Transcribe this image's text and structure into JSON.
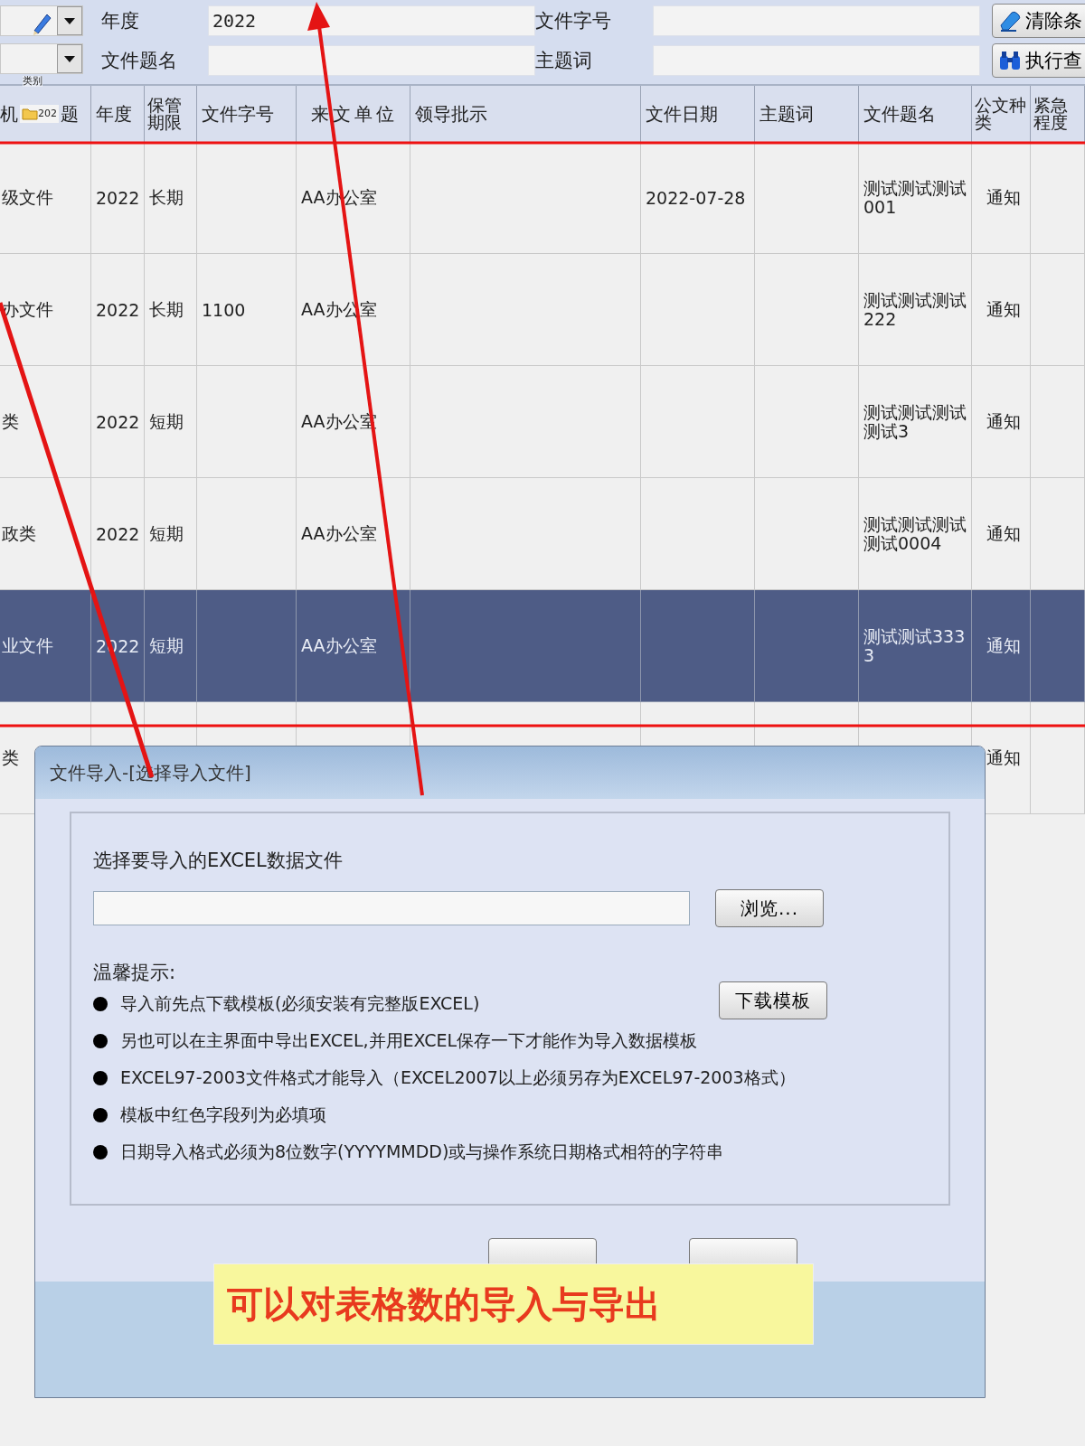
{
  "filter_bar": {
    "side_label": "类别",
    "fields": [
      {
        "label": "年度",
        "value": "2022"
      },
      {
        "label": "文件字号"
      },
      {
        "label": "文件题名"
      },
      {
        "label": "主题词"
      }
    ],
    "buttons": [
      {
        "kind": "clear",
        "label": "清除条"
      },
      {
        "kind": "search",
        "label": "执行查"
      }
    ]
  },
  "table": {
    "columns": [
      {
        "prefix": "机",
        "tag": "202",
        "label": "题"
      },
      {
        "label": "年度"
      },
      {
        "label": "保管期限"
      },
      {
        "label": "文件字号"
      },
      {
        "label": "来文单位"
      },
      {
        "label": "领导批示"
      },
      {
        "label": "文件日期"
      },
      {
        "label": "主题词"
      },
      {
        "label": "文件题名"
      },
      {
        "label": "公文种类"
      },
      {
        "label": "紧急程度"
      }
    ],
    "rows": [
      {
        "selected": false,
        "cells": [
          "级文件",
          "2022",
          "长期",
          "",
          "AA办公室",
          "",
          "2022-07-28",
          "",
          "测试测试测试001",
          "通知",
          ""
        ]
      },
      {
        "selected": false,
        "cells": [
          "办文件",
          "2022",
          "长期",
          "1100",
          "AA办公室",
          "",
          "",
          "",
          "测试测试测试222",
          "通知",
          ""
        ]
      },
      {
        "selected": false,
        "cells": [
          "类",
          "2022",
          "短期",
          "",
          "AA办公室",
          "",
          "",
          "",
          "测试测试测试测试3",
          "通知",
          ""
        ]
      },
      {
        "selected": false,
        "cells": [
          "政类",
          "2022",
          "短期",
          "",
          "AA办公室",
          "",
          "",
          "",
          "测试测试测试测试0004",
          "通知",
          ""
        ]
      },
      {
        "selected": true,
        "cells": [
          "业文件",
          "2022",
          "短期",
          "",
          "AA办公室",
          "",
          "",
          "",
          "测试测试3333",
          "通知",
          ""
        ]
      },
      {
        "selected": false,
        "cells": [
          "类",
          "",
          "",
          "",
          "",
          "",
          "",
          "",
          "",
          "通知",
          ""
        ]
      }
    ]
  },
  "dialog": {
    "title": "文件导入-[选择导入文件]",
    "file_prompt": "选择要导入的EXCEL数据文件",
    "browse_button": "浏览...",
    "tips_title": "温馨提示:",
    "template_button": "下载模板",
    "tips": [
      "导入前先点下载模板(必须安装有完整版EXCEL)",
      "另也可以在主界面中导出EXCEL,并用EXCEL保存一下才能作为导入数据模板",
      "EXCEL97-2003文件格式才能导入（EXCEL2007以上必须另存为EXCEL97-2003格式）",
      "模板中红色字段列为必填项",
      "日期导入格式必须为8位数字(YYYYMMDD)或与操作系统日期格式相符的字符串"
    ]
  },
  "annotation": {
    "text": "可以对表格数的导入与导出"
  }
}
